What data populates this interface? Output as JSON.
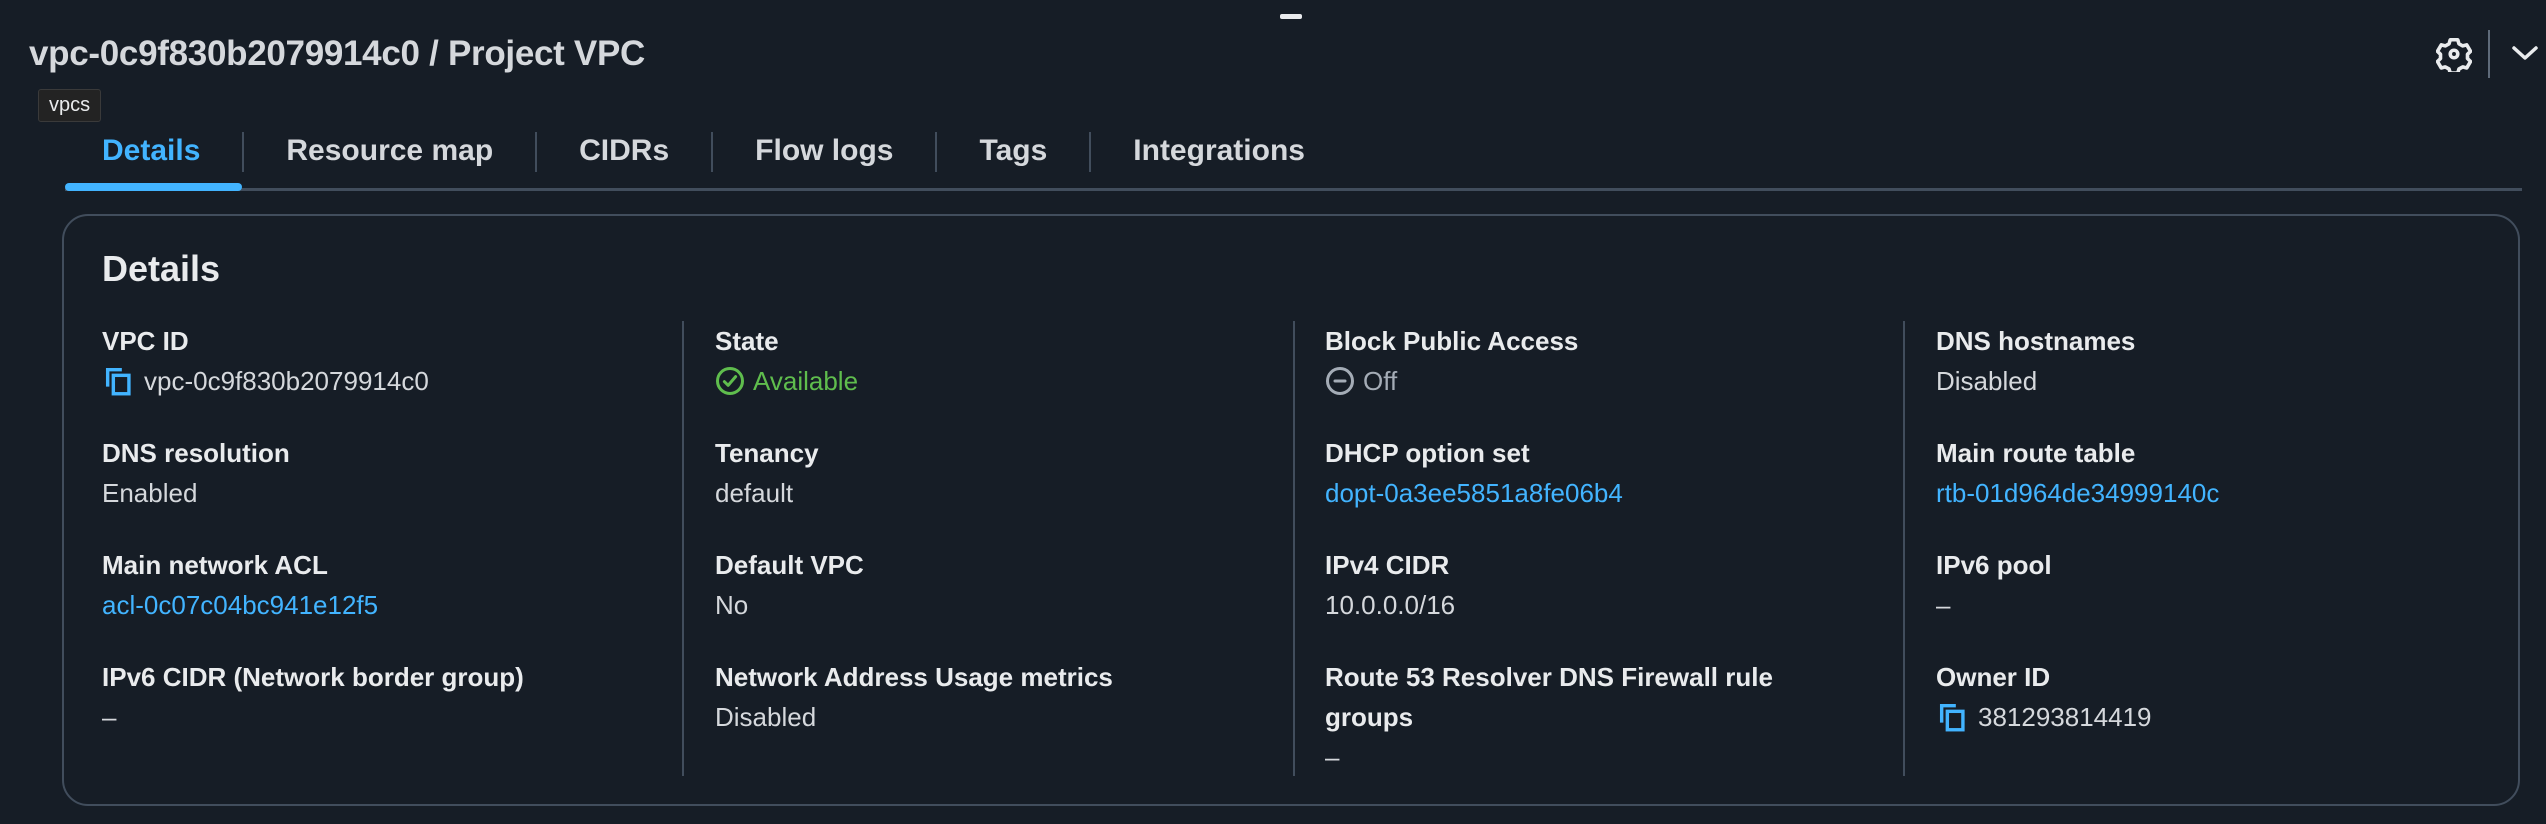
{
  "header": {
    "title": "vpc-0c9f830b2079914c0 / Project VPC",
    "tooltip": "vpcs",
    "icons": [
      "gear-icon",
      "chevron-down-icon"
    ]
  },
  "tabs": [
    {
      "label": "Details",
      "active": true
    },
    {
      "label": "Resource map"
    },
    {
      "label": "CIDRs"
    },
    {
      "label": "Flow logs"
    },
    {
      "label": "Tags"
    },
    {
      "label": "Integrations"
    }
  ],
  "details": {
    "title": "Details",
    "colors": {
      "link": "#42b4ff",
      "success": "#5fbd4d",
      "muted": "#a4acb6"
    },
    "columns": [
      [
        {
          "label": "VPC ID",
          "value": "vpc-0c9f830b2079914c0",
          "icon": "copy-icon"
        },
        {
          "label": "DNS resolution",
          "value": "Enabled"
        },
        {
          "label": "Main network ACL",
          "value": "acl-0c07c04bc941e12f5",
          "link": true
        },
        {
          "label": "IPv6 CIDR (Network border group)",
          "value": "–"
        }
      ],
      [
        {
          "label": "State",
          "value": "Available",
          "icon": "check-circle-icon"
        },
        {
          "label": "Tenancy",
          "value": "default"
        },
        {
          "label": "Default VPC",
          "value": "No"
        },
        {
          "label": "Network Address Usage metrics",
          "value": "Disabled"
        }
      ],
      [
        {
          "label": "Block Public Access",
          "value": "Off",
          "icon": "minus-circle-icon"
        },
        {
          "label": "DHCP option set",
          "value": "dopt-0a3ee5851a8fe06b4",
          "link": true
        },
        {
          "label": "IPv4 CIDR",
          "value": "10.0.0.0/16"
        },
        {
          "label": "Route 53 Resolver DNS Firewall rule groups",
          "value": "–"
        }
      ],
      [
        {
          "label": "DNS hostnames",
          "value": "Disabled"
        },
        {
          "label": "Main route table",
          "value": "rtb-01d964de34999140c",
          "link": true
        },
        {
          "label": "IPv6 pool",
          "value": "–"
        },
        {
          "label": "Owner ID",
          "value": "381293814419",
          "icon": "copy-icon"
        }
      ]
    ]
  }
}
